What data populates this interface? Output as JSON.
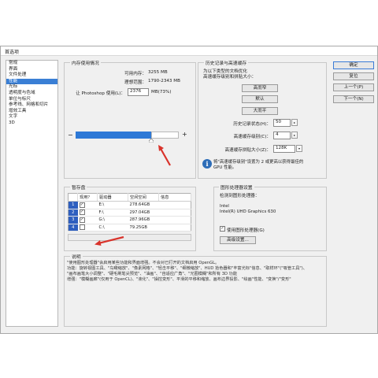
{
  "window": {
    "title": "首选项"
  },
  "sidebar": {
    "items": [
      {
        "label": "常规"
      },
      {
        "label": "界面"
      },
      {
        "label": "文件处理"
      },
      {
        "label": "性能",
        "selected": true
      },
      {
        "label": "光标"
      },
      {
        "label": "透明度与色域"
      },
      {
        "label": "单位与标尺"
      },
      {
        "label": "参考线、网格和切片"
      },
      {
        "label": "增效工具"
      },
      {
        "label": "文字"
      },
      {
        "label": "3D"
      }
    ]
  },
  "memory": {
    "title": "内存使用情况",
    "available_label": "可用内存：",
    "available_value": "3255 MB",
    "ideal_label": "理想范围：",
    "ideal_value": "1790-2343 MB",
    "let_label": "让 Photoshop 使用(L)：",
    "use_value": "2376",
    "use_unit": "MB(73%)",
    "minus": "−",
    "plus": "+",
    "slider_fraction": 0.73
  },
  "history": {
    "title": "历史记录与高速缓存",
    "hint_line1": "为以下类型的文档优化",
    "hint_line2": "高速缓存级别和拼贴大小：",
    "btn_tall": "高而窄",
    "btn_default": "默认",
    "btn_big": "大而平",
    "history_label": "历史记录状态(H)：",
    "history_value": "50",
    "cache_label": "高速缓存级别(C)：",
    "cache_value": "4",
    "tile_label": "高速缓存拼贴大小(Z)：",
    "tile_value": "128K",
    "info_line1": "将\"高速缓存级别\"设置为 2 或更高以获得最佳的",
    "info_line2": "GPU 性能。"
  },
  "buttons": {
    "ok": "确定",
    "reset": "复位",
    "prev": "上一个(P)",
    "next": "下一个(N)"
  },
  "scratch": {
    "title": "暂存盘",
    "headers": [
      "现用？",
      "驱动器",
      "空闲空间",
      "信息"
    ],
    "rows": [
      {
        "num": "1",
        "checked": true,
        "drive": "E:\\",
        "free": "278.64GB"
      },
      {
        "num": "2",
        "checked": true,
        "drive": "F:\\",
        "free": "297.04GB"
      },
      {
        "num": "3",
        "checked": true,
        "drive": "G:\\",
        "free": "287.96GB"
      },
      {
        "num": "4",
        "checked": false,
        "drive": "C:\\",
        "free": "79.25GB"
      }
    ]
  },
  "gpu": {
    "title": "图形处理器设置",
    "detected_label": "检测到图形处理器：",
    "vendor": "Intel",
    "model": "Intel(R) UHD Graphics 630",
    "use_gpu_label": "使用图形处理器(G)",
    "use_gpu_checked": true,
    "advanced_button": "高级设置..."
  },
  "description": {
    "title": "说明",
    "lines": [
      "\"使用图形处理器\"会启用某些功能和界面增强。不会对已打开的文档启用 OpenGL。",
      "功能：旋转视图工具、\"鸟瞰缩放\"、\"像素网格\"、\"轻击平移\"、\"细微缩放\"、HUD 拾色器和\"丰富光标\"信息、\"取样环\"(\"吸管工具\")、",
      "\"画布画笔大小调整\"、\"硬毛刷笔尖预览\"、\"油画\"、\"自适应广角\"、\"光圈模糊\"和所有 3D 功能",
      "增强：\"模糊画廊\"(仅用于 OpenCL)、\"液化\"、\"操控变形\"、平滑的平移和缩放、画布边界投影、\"绘画\"性能、\"变换\"/\"变形\""
    ]
  },
  "colors": {
    "selection": "#3a7fd5",
    "arrow": "#d9332b"
  }
}
